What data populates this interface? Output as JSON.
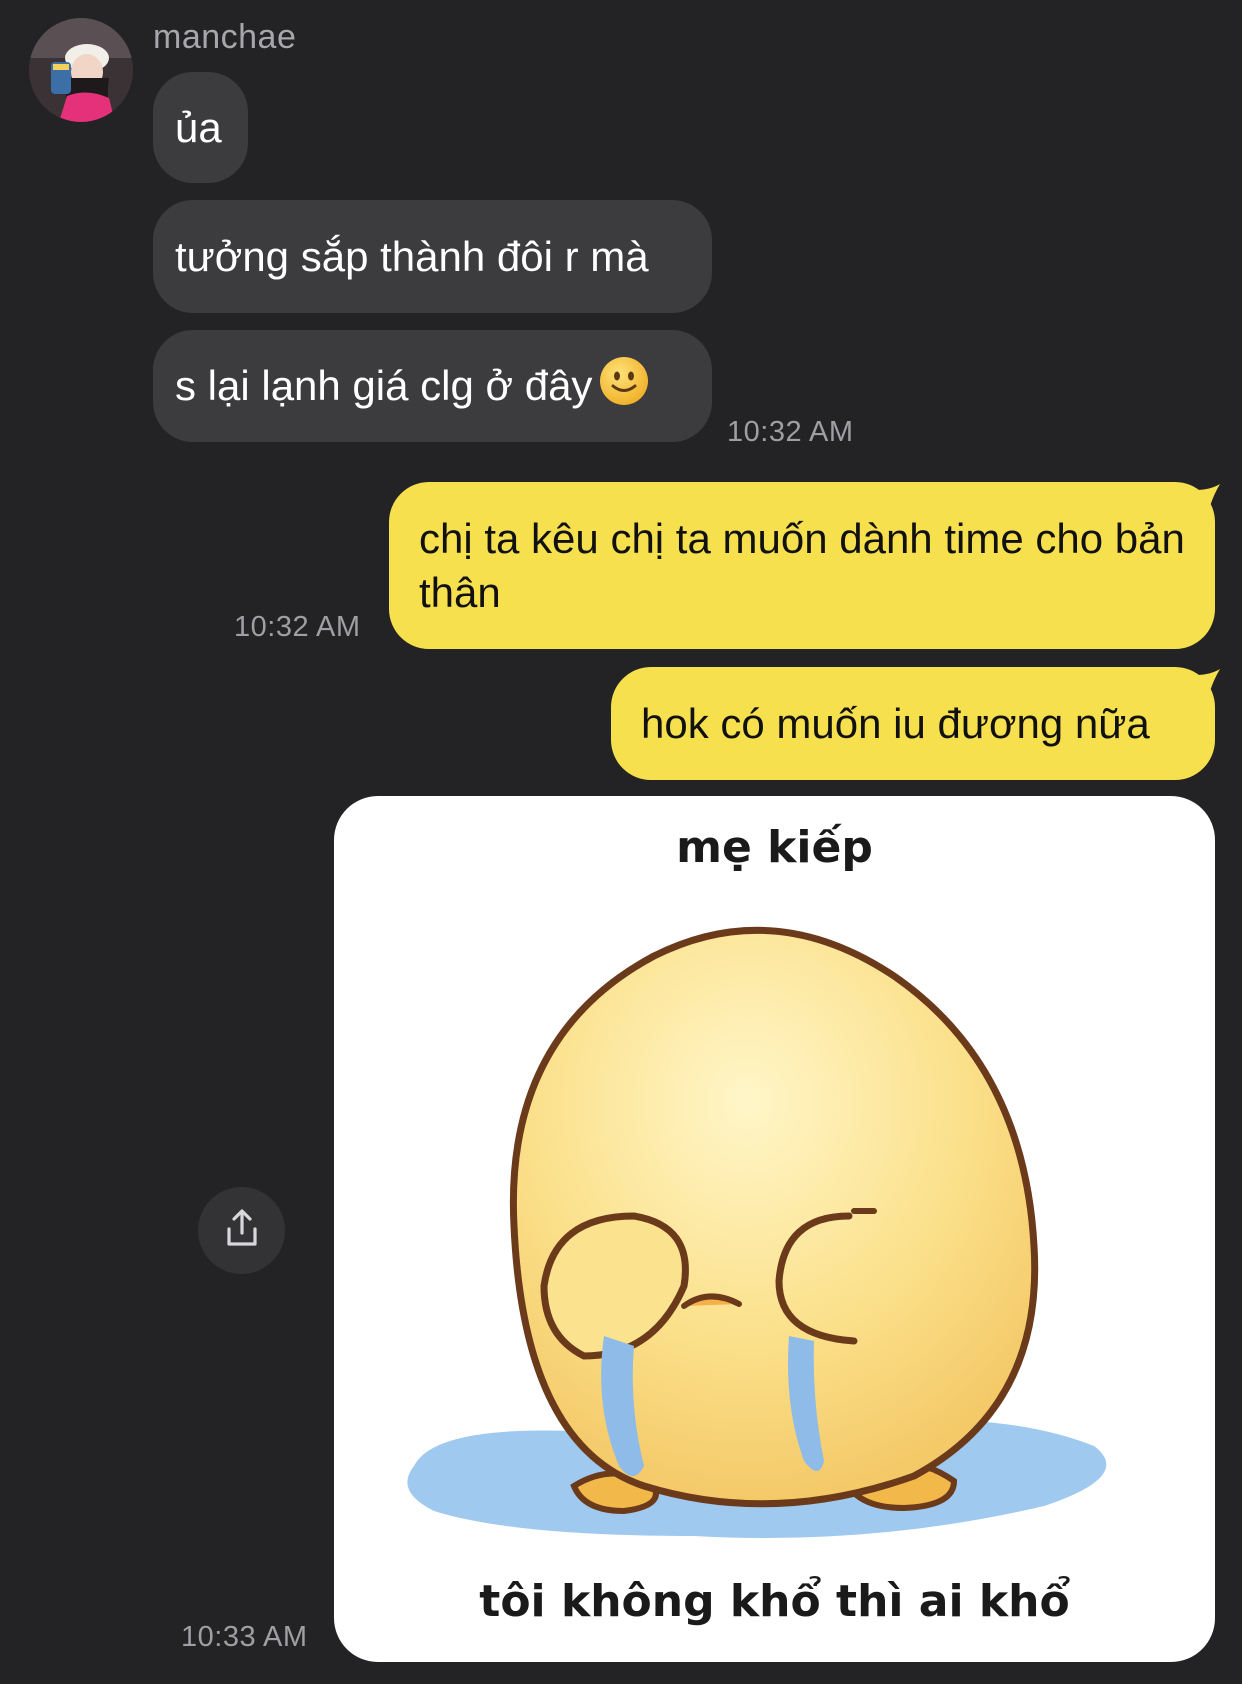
{
  "contact": {
    "name": "manchae"
  },
  "incoming": [
    {
      "text": "ủa"
    },
    {
      "text": "tưởng sắp thành đôi r mà"
    },
    {
      "text": "s lại lạnh giá clg ở đây"
    }
  ],
  "incoming_time": "10:32 AM",
  "outgoing": [
    {
      "text": "chị ta kêu chị ta muốn dành time cho bản thân",
      "time": "10:32 AM"
    },
    {
      "text": "hok có muốn iu đương nữa"
    }
  ],
  "sticker": {
    "top_text": "mẹ kiếp",
    "bottom_text": "tôi không khổ thì ai khổ",
    "time": "10:33 AM"
  },
  "icons": {
    "share": "share-icon",
    "emoji": "slightly-smiling-face-icon"
  },
  "colors": {
    "background": "#232325",
    "incoming_bubble": "#3c3c3f",
    "outgoing_bubble": "#f7e04e"
  }
}
